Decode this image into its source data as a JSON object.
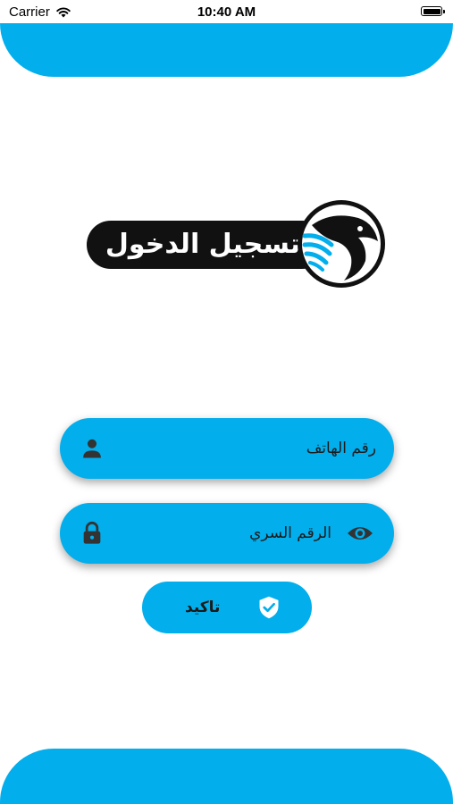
{
  "status_bar": {
    "carrier": "Carrier",
    "time": "10:40 AM",
    "battery_level": 1.0
  },
  "logo": {
    "title": "تسجيل الدخول",
    "emblem_icon": "eagle-icon"
  },
  "form": {
    "phone_label": "رقم الهاتف",
    "password_label": "الرقم السري",
    "confirm_label": "تاكيد"
  },
  "colors": {
    "accent": "#02aeec",
    "dark": "#111111",
    "icon": "#333333"
  }
}
